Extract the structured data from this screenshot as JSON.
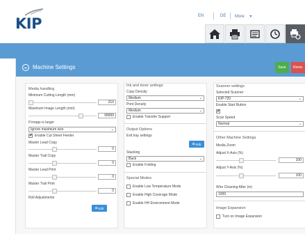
{
  "header": {
    "logo_text": "KIP",
    "languages": [
      "EN",
      "DE",
      "More"
    ],
    "more_caret": "▾"
  },
  "nav": {
    "buttons": [
      {
        "icon": "home-icon"
      },
      {
        "icon": "printer-icon"
      },
      {
        "icon": "documents-icon"
      },
      {
        "icon": "clock-icon"
      },
      {
        "icon": "printer-settings-icon",
        "active": true
      },
      {
        "icon": "partial-icon"
      }
    ]
  },
  "panel": {
    "title": "Machine Settings",
    "save_label": "Save",
    "remove_label": "Remo"
  },
  "media_handling": {
    "title": "Media handling",
    "min_cut_label": "Minimum Cutting Length (mm)",
    "min_cut_value": "210",
    "max_len_label": "Maximum Image Length (mm)",
    "max_len_value": "99999",
    "if_larger_label": "If image is larger",
    "if_larger_value": "Ignore maximum size",
    "cut_sheet_label": "Enable Cut Sheet Feeder",
    "cut_sheet_checked": true,
    "master_lead_copy_label": "Master Lead Copy",
    "master_lead_copy_value": "0",
    "master_trail_copy_label": "Master Trail Copy",
    "master_trail_copy_value": "0",
    "master_lead_print_label": "Master Lead Print",
    "master_lead_print_value": "0",
    "master_trail_print_label": "Master Trail Print",
    "master_trail_print_value": "0",
    "roll_adjustments_label": "Roll Adjustments",
    "edit_label": "Edit"
  },
  "ink_toner": {
    "title": "Ink and toner settings",
    "copy_density_label": "Copy Density",
    "copy_density_value": "Medium",
    "print_density_label": "Print Density",
    "print_density_value": "Medium",
    "transfer_support_label": "Enable Transfer Support",
    "transfer_support_checked": false
  },
  "output_options": {
    "title": "Output Options",
    "exit_tray_label": "Exit tray settings",
    "edit_label": "Edit",
    "stacking_label": "Stacking",
    "stacking_value": "Back",
    "folding_label": "Enable Folding",
    "folding_checked": false
  },
  "special_modes": {
    "title": "Special Modes",
    "low_temp_label": "Enable Low Temperature Mode",
    "high_coverage_label": "Enable High Coverage Mode",
    "hh_env_label": "Enable HH Environment Mode"
  },
  "scanner": {
    "title": "Scanner settings",
    "selected_label": "Selected Scanner",
    "selected_value": "KIP-720",
    "start_button_label": "Enable Start Button",
    "start_button_checked": true,
    "scan_speed_label": "Scan Speed",
    "scan_speed_value": "Normal"
  },
  "other_machine": {
    "title": "Other Machine Settings",
    "media_zoom_label": "Media Zoom",
    "adjust_x_label": "Adjust X-Axis (%)",
    "adjust_x_value": "100",
    "adjust_y_label": "Adjust Y-Axis (%)",
    "adjust_y_value": "100",
    "wire_clean_label": "Wire Cleaning After (m)",
    "wire_clean_value": "1000"
  },
  "image_expansion": {
    "title": "Image Expansion",
    "turn_on_label": "Turn on Image Expansion",
    "turn_on_checked": false
  },
  "colors": {
    "accent_blue": "#5b9bd4",
    "save_green": "#4cae4c",
    "remove_red": "#d9534f",
    "logo_blue": "#1d4f86",
    "edit_blue": "#3a8fd8"
  }
}
